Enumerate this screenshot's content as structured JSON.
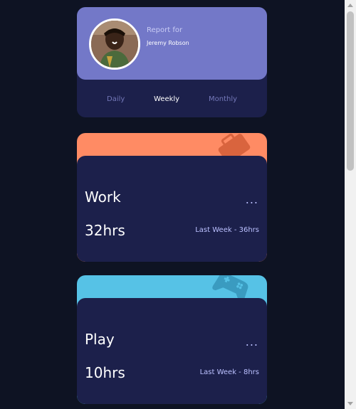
{
  "profile": {
    "report_label": "Report for",
    "name": "Jeremy Robson",
    "avatar_icon": "avatar-photo"
  },
  "tabs": [
    {
      "label": "Daily",
      "active": false
    },
    {
      "label": "Weekly",
      "active": true
    },
    {
      "label": "Monthly",
      "active": false
    }
  ],
  "activities": [
    {
      "title": "Work",
      "hours": "32hrs",
      "previous": "Last Week - 36hrs",
      "menu": "...",
      "color": "#ff8b64",
      "icon": "briefcase-icon"
    },
    {
      "title": "Play",
      "hours": "10hrs",
      "previous": "Last Week - 8hrs",
      "menu": "...",
      "color": "#56c2e6",
      "icon": "gamepad-icon"
    }
  ],
  "colors": {
    "background": "#0e1323",
    "card": "#1c204b",
    "profile": "#7378c8",
    "muted_text": "#bbc0ff"
  }
}
